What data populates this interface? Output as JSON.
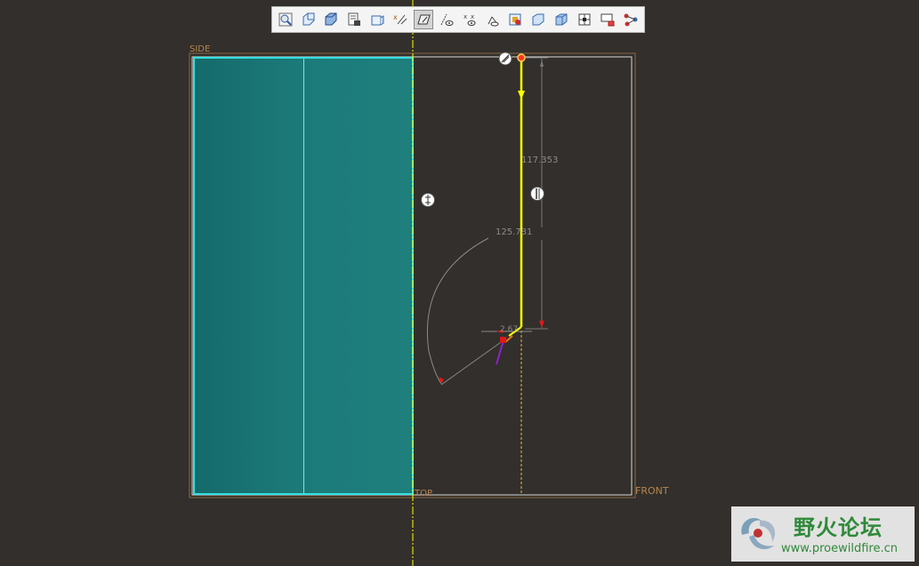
{
  "toolbar": {
    "buttons": [
      {
        "name": "refit-view-icon",
        "active": false
      },
      {
        "name": "zoom-in-icon",
        "active": false
      },
      {
        "name": "display-style-icon",
        "active": false
      },
      {
        "name": "saved-orientations-icon",
        "active": false
      },
      {
        "name": "view-manager-icon",
        "active": false
      },
      {
        "name": "datum-display-filters-icon",
        "active": false
      },
      {
        "name": "sketch-view-icon",
        "active": true
      },
      {
        "name": "dimension-display-icon",
        "active": false
      },
      {
        "name": "constraints-display-icon",
        "active": false
      },
      {
        "name": "grid-display-icon",
        "active": false
      },
      {
        "name": "vertex-display-icon",
        "active": false
      },
      {
        "name": "shade-closed-loops-icon",
        "active": false
      },
      {
        "name": "highlight-open-ends-icon",
        "active": false
      },
      {
        "name": "overlapping-geometry-icon",
        "active": false
      },
      {
        "name": "sketch-setup-icon",
        "active": false
      },
      {
        "name": "references-icon",
        "active": false
      },
      {
        "name": "modify-icon",
        "active": false
      }
    ]
  },
  "planes": {
    "side": "SIDE",
    "top": "TOP",
    "front": "FRONT"
  },
  "dimensions": {
    "height": "117.353",
    "radius": "125.781",
    "small": "2.67"
  },
  "watermark": {
    "title": "野火论坛",
    "url": "www.proewildfire.cn"
  },
  "colors": {
    "background": "#322f2c",
    "teal_fill": "#1d7c7b",
    "sketch_yellow": "#ffff00",
    "datum_plane": "#b8864e",
    "constraint_red": "#e01818"
  }
}
